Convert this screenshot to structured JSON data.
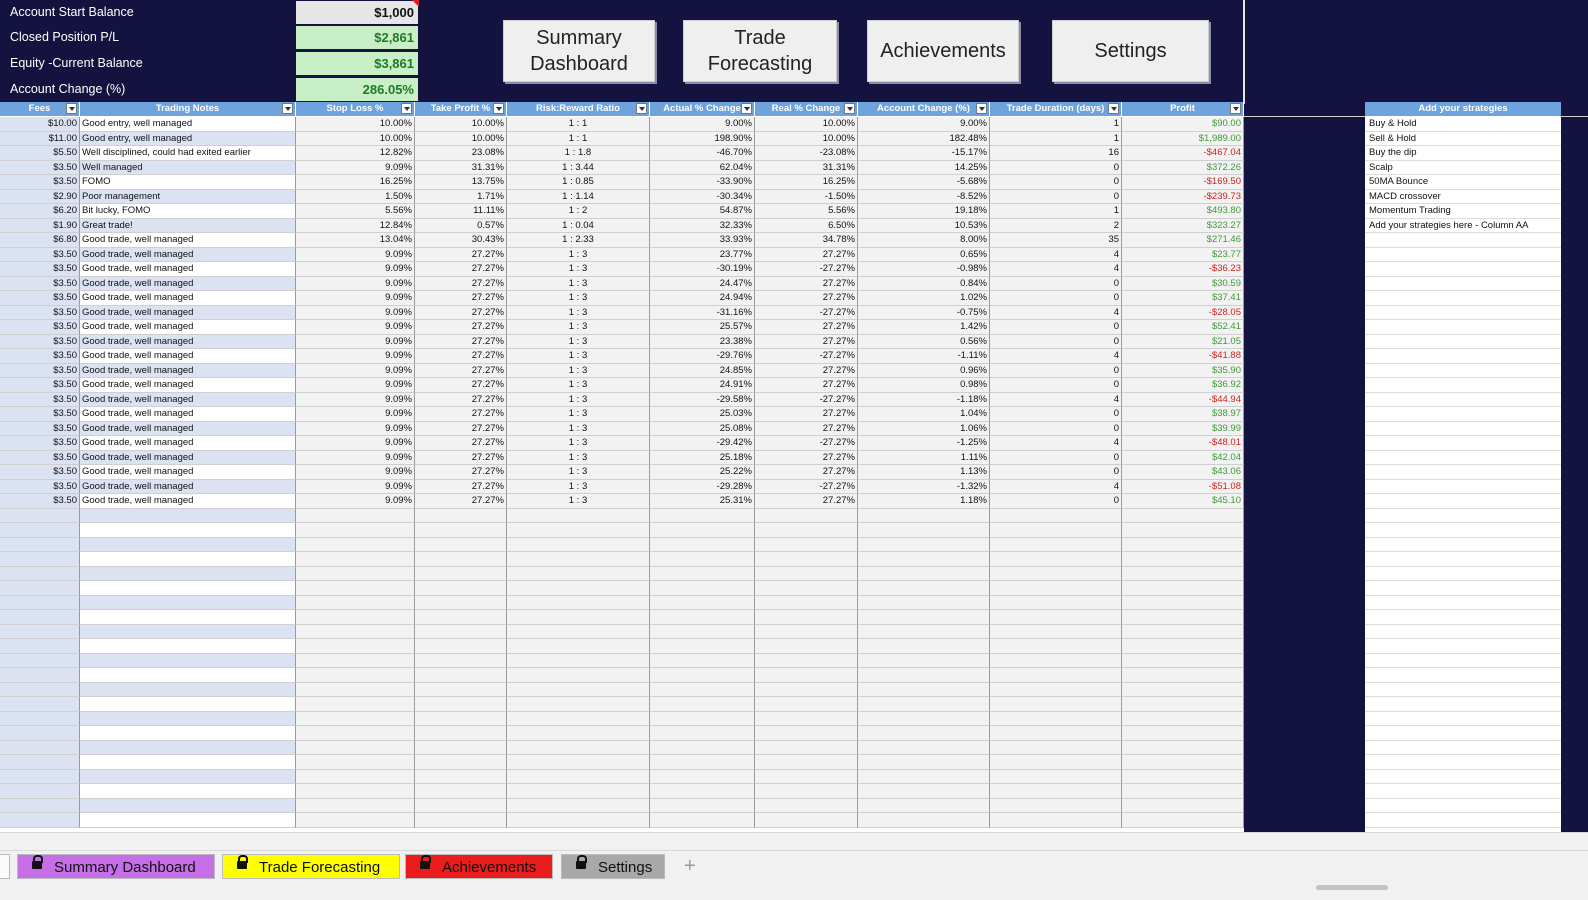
{
  "summary": [
    {
      "label": "Account Start Balance",
      "value": "$1,000"
    },
    {
      "label": "Closed Position P/L",
      "value": "$2,861"
    },
    {
      "label": "Equity -Current Balance",
      "value": "$3,861"
    },
    {
      "label": "Account Change (%)",
      "value": "286.05%"
    }
  ],
  "nav": {
    "summary": "Summary\nDashboard",
    "forecast": "Trade\nForecasting",
    "achievements": "Achievements",
    "settings": "Settings"
  },
  "headers": [
    "Fees",
    "Trading Notes",
    "Stop Loss %",
    "Take Profit %",
    "Risk:Reward Ratio",
    "Actual % Change",
    "Real % Change",
    "Account Change (%)",
    "Trade Duration (days)",
    "Profit"
  ],
  "rows": [
    [
      "$10.00",
      "Good entry, well managed",
      "10.00%",
      "10.00%",
      "1 : 1",
      "9.00%",
      "10.00%",
      "9.00%",
      "1",
      "$90.00"
    ],
    [
      "$11.00",
      "Good entry, well managed",
      "10.00%",
      "10.00%",
      "1 : 1",
      "198.90%",
      "10.00%",
      "182.48%",
      "1",
      "$1,989.00"
    ],
    [
      "$5.50",
      "Well disciplined, could had exited earlier",
      "12.82%",
      "23.08%",
      "1 : 1.8",
      "-46.70%",
      "-23.08%",
      "-15.17%",
      "16",
      "-$467.04"
    ],
    [
      "$3.50",
      "Well managed",
      "9.09%",
      "31.31%",
      "1 : 3.44",
      "62.04%",
      "31.31%",
      "14.25%",
      "0",
      "$372.26"
    ],
    [
      "$3.50",
      "FOMO",
      "16.25%",
      "13.75%",
      "1 : 0.85",
      "-33.90%",
      "16.25%",
      "-5.68%",
      "0",
      "-$169.50"
    ],
    [
      "$2.90",
      "Poor management",
      "1.50%",
      "1.71%",
      "1 : 1.14",
      "-30.34%",
      "-1.50%",
      "-8.52%",
      "0",
      "-$239.73"
    ],
    [
      "$6.20",
      "Bit lucky, FOMO",
      "5.56%",
      "11.11%",
      "1 : 2",
      "54.87%",
      "5.56%",
      "19.18%",
      "1",
      "$493.80"
    ],
    [
      "$1.90",
      "Great trade!",
      "12.84%",
      "0.57%",
      "1 : 0.04",
      "32.33%",
      "6.50%",
      "10.53%",
      "2",
      "$323.27"
    ],
    [
      "$6.80",
      "Good trade, well managed",
      "13.04%",
      "30.43%",
      "1 : 2.33",
      "33.93%",
      "34.78%",
      "8.00%",
      "35",
      "$271.46"
    ],
    [
      "$3.50",
      "Good trade, well managed",
      "9.09%",
      "27.27%",
      "1 : 3",
      "23.77%",
      "27.27%",
      "0.65%",
      "4",
      "$23.77"
    ],
    [
      "$3.50",
      "Good trade, well managed",
      "9.09%",
      "27.27%",
      "1 : 3",
      "-30.19%",
      "-27.27%",
      "-0.98%",
      "4",
      "-$36.23"
    ],
    [
      "$3.50",
      "Good trade, well managed",
      "9.09%",
      "27.27%",
      "1 : 3",
      "24.47%",
      "27.27%",
      "0.84%",
      "0",
      "$30.59"
    ],
    [
      "$3.50",
      "Good trade, well managed",
      "9.09%",
      "27.27%",
      "1 : 3",
      "24.94%",
      "27.27%",
      "1.02%",
      "0",
      "$37.41"
    ],
    [
      "$3.50",
      "Good trade, well managed",
      "9.09%",
      "27.27%",
      "1 : 3",
      "-31.16%",
      "-27.27%",
      "-0.75%",
      "4",
      "-$28.05"
    ],
    [
      "$3.50",
      "Good trade, well managed",
      "9.09%",
      "27.27%",
      "1 : 3",
      "25.57%",
      "27.27%",
      "1.42%",
      "0",
      "$52.41"
    ],
    [
      "$3.50",
      "Good trade, well managed",
      "9.09%",
      "27.27%",
      "1 : 3",
      "23.38%",
      "27.27%",
      "0.56%",
      "0",
      "$21.05"
    ],
    [
      "$3.50",
      "Good trade, well managed",
      "9.09%",
      "27.27%",
      "1 : 3",
      "-29.76%",
      "-27.27%",
      "-1.11%",
      "4",
      "-$41.88"
    ],
    [
      "$3.50",
      "Good trade, well managed",
      "9.09%",
      "27.27%",
      "1 : 3",
      "24.85%",
      "27.27%",
      "0.96%",
      "0",
      "$35.90"
    ],
    [
      "$3.50",
      "Good trade, well managed",
      "9.09%",
      "27.27%",
      "1 : 3",
      "24.91%",
      "27.27%",
      "0.98%",
      "0",
      "$36.92"
    ],
    [
      "$3.50",
      "Good trade, well managed",
      "9.09%",
      "27.27%",
      "1 : 3",
      "-29.58%",
      "-27.27%",
      "-1.18%",
      "4",
      "-$44.94"
    ],
    [
      "$3.50",
      "Good trade, well managed",
      "9.09%",
      "27.27%",
      "1 : 3",
      "25.03%",
      "27.27%",
      "1.04%",
      "0",
      "$38.97"
    ],
    [
      "$3.50",
      "Good trade, well managed",
      "9.09%",
      "27.27%",
      "1 : 3",
      "25.08%",
      "27.27%",
      "1.06%",
      "0",
      "$39.99"
    ],
    [
      "$3.50",
      "Good trade, well managed",
      "9.09%",
      "27.27%",
      "1 : 3",
      "-29.42%",
      "-27.27%",
      "-1.25%",
      "4",
      "-$48.01"
    ],
    [
      "$3.50",
      "Good trade, well managed",
      "9.09%",
      "27.27%",
      "1 : 3",
      "25.18%",
      "27.27%",
      "1.11%",
      "0",
      "$42.04"
    ],
    [
      "$3.50",
      "Good trade, well managed",
      "9.09%",
      "27.27%",
      "1 : 3",
      "25.22%",
      "27.27%",
      "1.13%",
      "0",
      "$43.06"
    ],
    [
      "$3.50",
      "Good trade, well managed",
      "9.09%",
      "27.27%",
      "1 : 3",
      "-29.28%",
      "-27.27%",
      "-1.32%",
      "4",
      "-$51.08"
    ],
    [
      "$3.50",
      "Good trade, well managed",
      "9.09%",
      "27.27%",
      "1 : 3",
      "25.31%",
      "27.27%",
      "1.18%",
      "0",
      "$45.10"
    ]
  ],
  "strategies": {
    "header": "Add your strategies",
    "items": [
      "Buy & Hold",
      "Sell & Hold",
      "Buy the dip",
      "Scalp",
      "50MA Bounce",
      "MACD crossover",
      "Momentum Trading",
      "Add your strategies here - Column AA"
    ]
  },
  "tabs": [
    {
      "label": "Summary Dashboard",
      "color": "#c56ee8"
    },
    {
      "label": "Trade Forecasting",
      "color": "#ffff00"
    },
    {
      "label": "Achievements",
      "color": "#ea1c1c"
    },
    {
      "label": "Settings",
      "color": "#a8a8a8"
    }
  ],
  "add_tab_label": "+",
  "colors": {
    "profit_positive": "#3f9a3a",
    "profit_negative": "#d41f1f",
    "header_blue": "#6fa3dd",
    "background_navy": "#14133f"
  }
}
